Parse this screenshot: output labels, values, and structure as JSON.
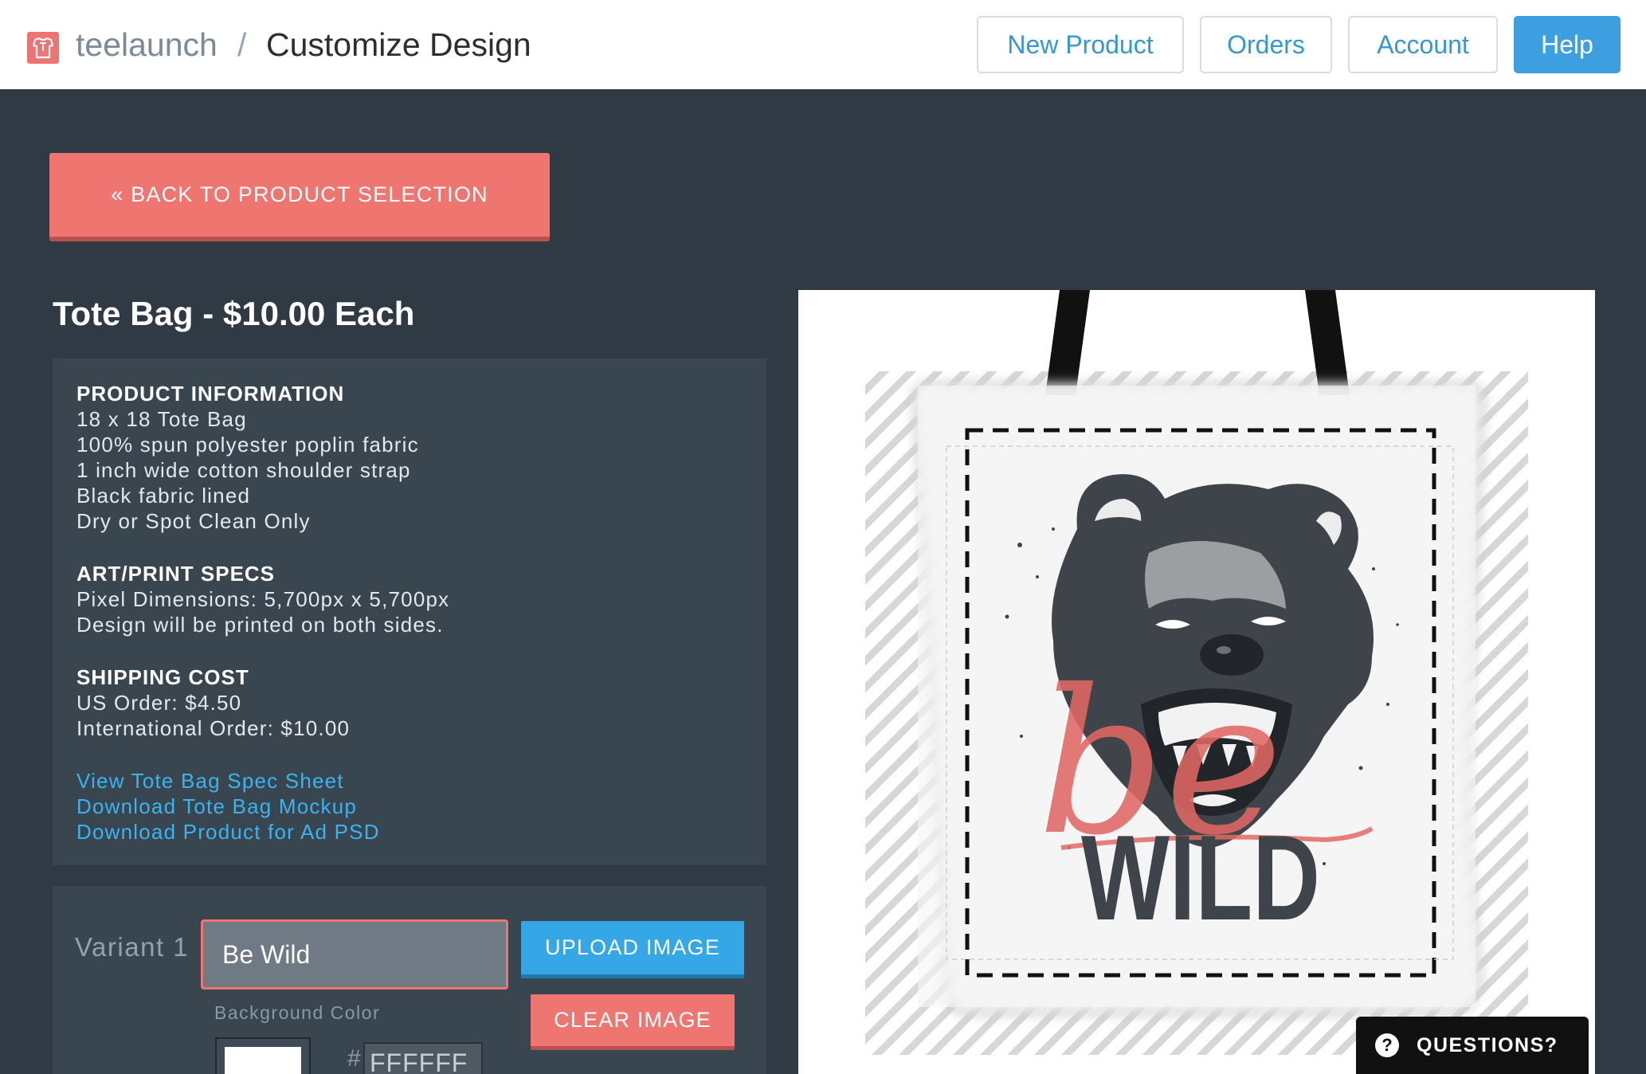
{
  "header": {
    "brand": "teelaunch",
    "separator": "/",
    "title": "Customize Design",
    "nav": [
      {
        "label": "New Product"
      },
      {
        "label": "Orders"
      },
      {
        "label": "Account"
      },
      {
        "label": "Help"
      }
    ]
  },
  "back_button": {
    "label": "« BACK TO PRODUCT SELECTION"
  },
  "product": {
    "title": "Tote Bag - $10.00 Each",
    "info": {
      "product_information": {
        "heading": "PRODUCT INFORMATION",
        "lines": [
          "18 x 18 Tote Bag",
          "100% spun polyester poplin fabric",
          "1 inch wide cotton shoulder strap",
          "Black fabric lined",
          "Dry or Spot Clean Only"
        ]
      },
      "art_print_specs": {
        "heading": "ART/PRINT SPECS",
        "lines": [
          "Pixel Dimensions: 5,700px x 5,700px",
          "Design will be printed on both sides."
        ]
      },
      "shipping_cost": {
        "heading": "SHIPPING COST",
        "lines": [
          "US Order: $4.50",
          "International Order: $10.00"
        ]
      },
      "links": [
        "View Tote Bag Spec Sheet",
        "Download Tote Bag Mockup",
        "Download Product for Ad PSD"
      ]
    }
  },
  "variant": {
    "label": "Variant 1",
    "name_value": "Be Wild",
    "upload_label": "UPLOAD IMAGE",
    "clear_label": "CLEAR IMAGE",
    "bg_color_label": "Background Color",
    "hash": "#",
    "bg_color_value": "FFFFFF"
  },
  "preview": {
    "artwork_text_script": "be",
    "artwork_text_block": "WILD"
  },
  "questions": {
    "icon": "?",
    "label": "QUESTIONS?"
  },
  "colors": {
    "accent_coral": "#ef7570",
    "accent_blue": "#35a7e6",
    "link_blue": "#3ab4f0",
    "background_dark": "#2f3a44",
    "panel": "#39454f"
  }
}
